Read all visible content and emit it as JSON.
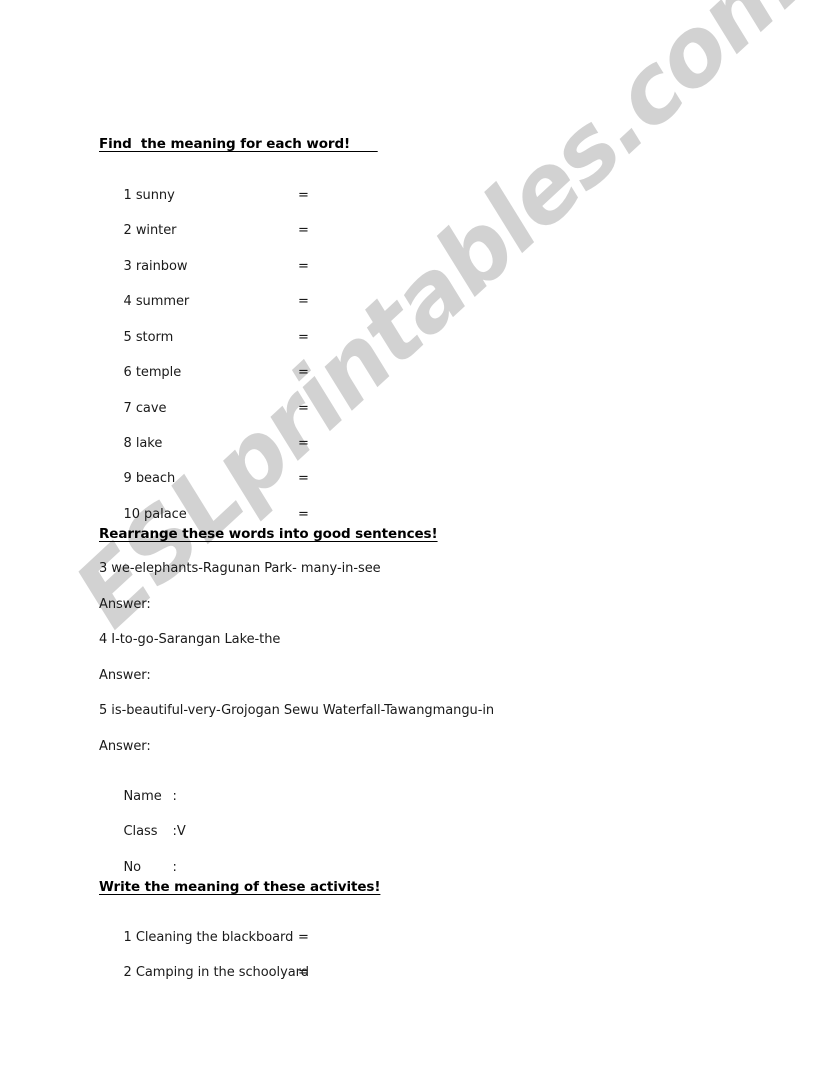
{
  "document": {
    "watermark": "ESLprintables.com",
    "watermark_color": "#d2d2d2",
    "text_color": "#1a1a1a",
    "background_color": "#ffffff"
  },
  "sections": {
    "vocabulary": {
      "heading": "Find  the meaning for each word!      ",
      "equals_sign": "=",
      "items": [
        {
          "number": "1",
          "word": "sunny"
        },
        {
          "number": "2",
          "word": "winter"
        },
        {
          "number": "3",
          "word": "rainbow"
        },
        {
          "number": "4",
          "word": "summer"
        },
        {
          "number": "5",
          "word": "storm"
        },
        {
          "number": "6",
          "word": "temple"
        },
        {
          "number": "7",
          "word": "cave"
        },
        {
          "number": "8",
          "word": "lake"
        },
        {
          "number": "9",
          "word": "beach"
        },
        {
          "number": "10",
          "word": "palace"
        }
      ]
    },
    "rearrange": {
      "heading": "Rearrange these words into good sentences!",
      "answer_label": "Answer:",
      "items": [
        {
          "prompt": "3 we-elephants-Ragunan Park- many-in-see"
        },
        {
          "prompt": "4 I-to-go-Sarangan Lake-the"
        },
        {
          "prompt": "5 is-beautiful-very-Grojogan Sewu Waterfall-Tawangmangu-in"
        }
      ]
    },
    "student_fields": [
      {
        "label": "Name",
        "colon": ":",
        "value": ""
      },
      {
        "label": "Class",
        "colon": ":",
        "value": "V"
      },
      {
        "label": "No",
        "colon": ":",
        "value": ""
      }
    ],
    "activities": {
      "heading": "Write the meaning of these activites!",
      "equals_sign": "=",
      "items": [
        {
          "number": "1",
          "text": "Cleaning the blackboard"
        },
        {
          "number": "2",
          "text": "Camping in the schoolyard"
        }
      ]
    }
  }
}
